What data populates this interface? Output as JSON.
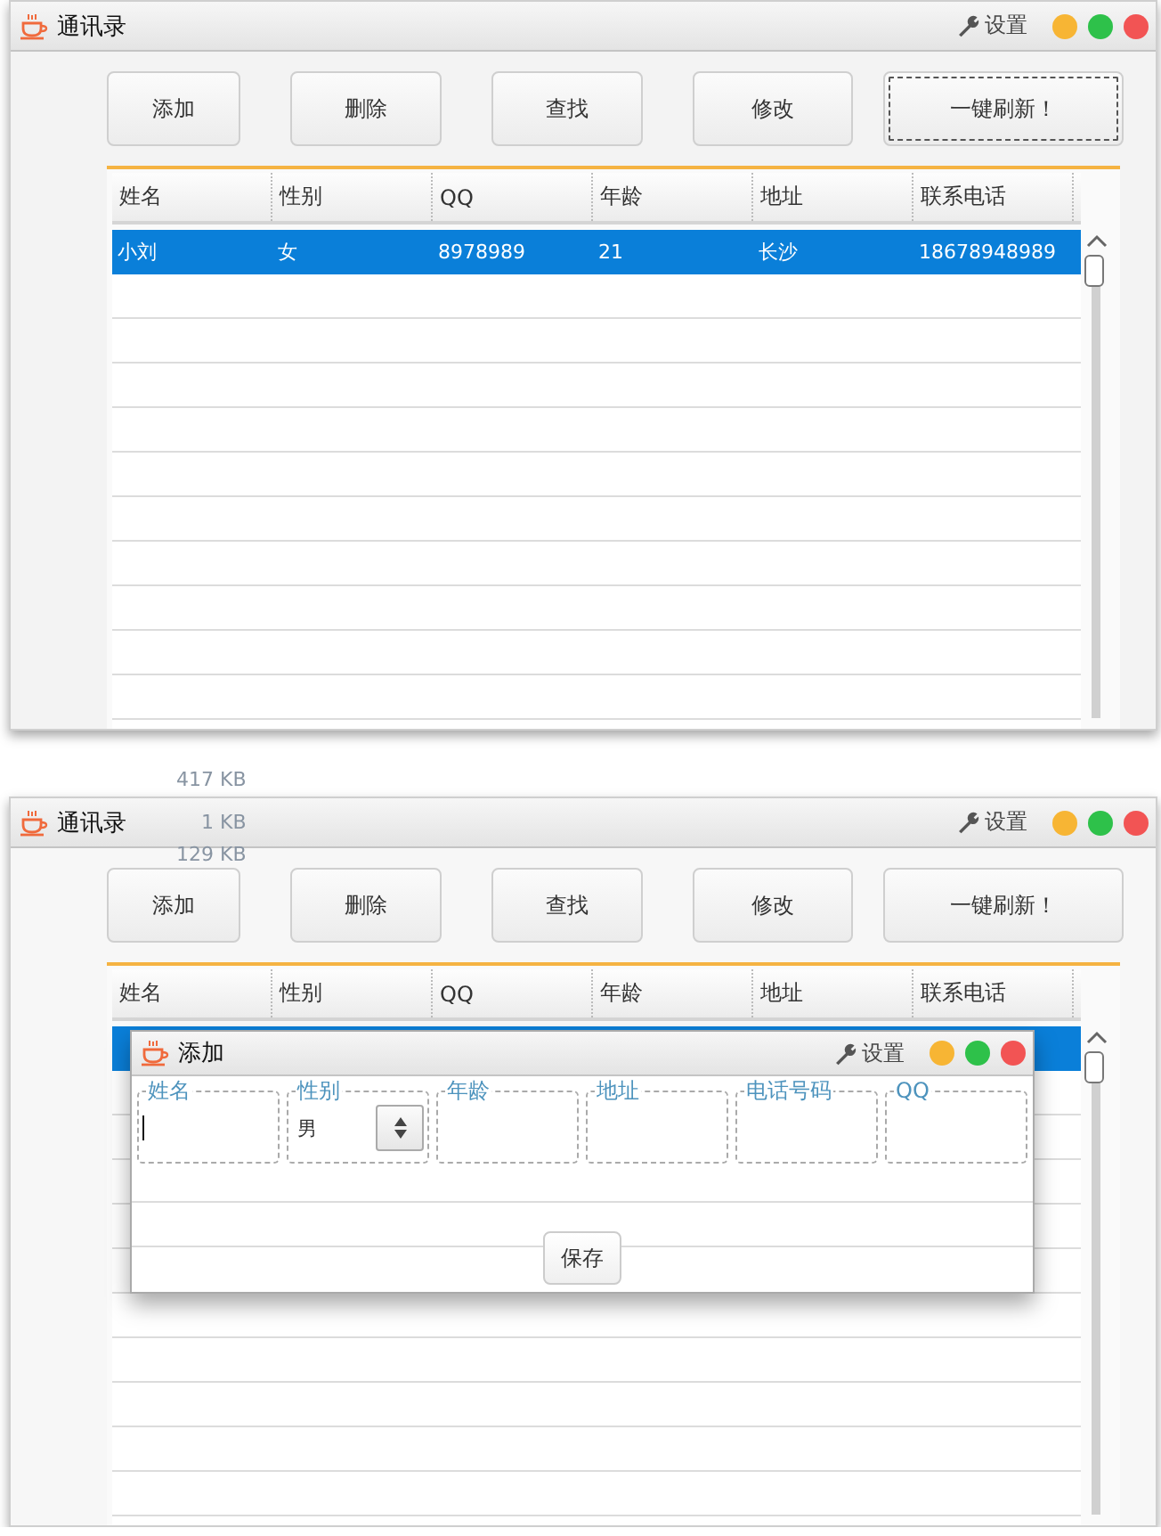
{
  "windows": [
    {
      "title": "通讯录",
      "settings_label": "设置",
      "buttons": [
        {
          "label": "添加",
          "focused": false
        },
        {
          "label": "删除",
          "focused": false
        },
        {
          "label": "查找",
          "focused": false
        },
        {
          "label": "修改",
          "focused": false
        },
        {
          "label": "一键刷新！",
          "focused": true
        }
      ],
      "table": {
        "columns": [
          "姓名",
          "性别",
          "QQ",
          "年龄",
          "地址",
          "联系电话"
        ],
        "rows": [
          {
            "selected": true,
            "cells": [
              "小刘",
              "女",
              "8978989",
              "21",
              "长沙",
              "18678948989"
            ]
          }
        ]
      }
    },
    {
      "title": "通讯录",
      "settings_label": "设置",
      "background_labels": [
        "417 KB",
        "1 KB",
        "129 KB"
      ],
      "buttons": [
        {
          "label": "添加",
          "focused": false
        },
        {
          "label": "删除",
          "focused": false
        },
        {
          "label": "查找",
          "focused": false
        },
        {
          "label": "修改",
          "focused": false
        },
        {
          "label": "一键刷新！",
          "focused": false
        }
      ],
      "table": {
        "columns": [
          "姓名",
          "性别",
          "QQ",
          "年龄",
          "地址",
          "联系电话"
        ],
        "rows": [
          {
            "selected": true
          }
        ]
      },
      "dialog": {
        "title": "添加",
        "settings_label": "设置",
        "fields": [
          {
            "label": "姓名",
            "kind": "text",
            "focused": true
          },
          {
            "label": "性别",
            "kind": "spinner",
            "value": "男",
            "focused": false
          },
          {
            "label": "年龄",
            "kind": "text",
            "focused": false
          },
          {
            "label": "地址",
            "kind": "text",
            "focused": false
          },
          {
            "label": "电话号码",
            "kind": "text",
            "focused": false
          },
          {
            "label": "QQ",
            "kind": "text",
            "focused": false
          }
        ],
        "save_button": "保存"
      }
    }
  ]
}
